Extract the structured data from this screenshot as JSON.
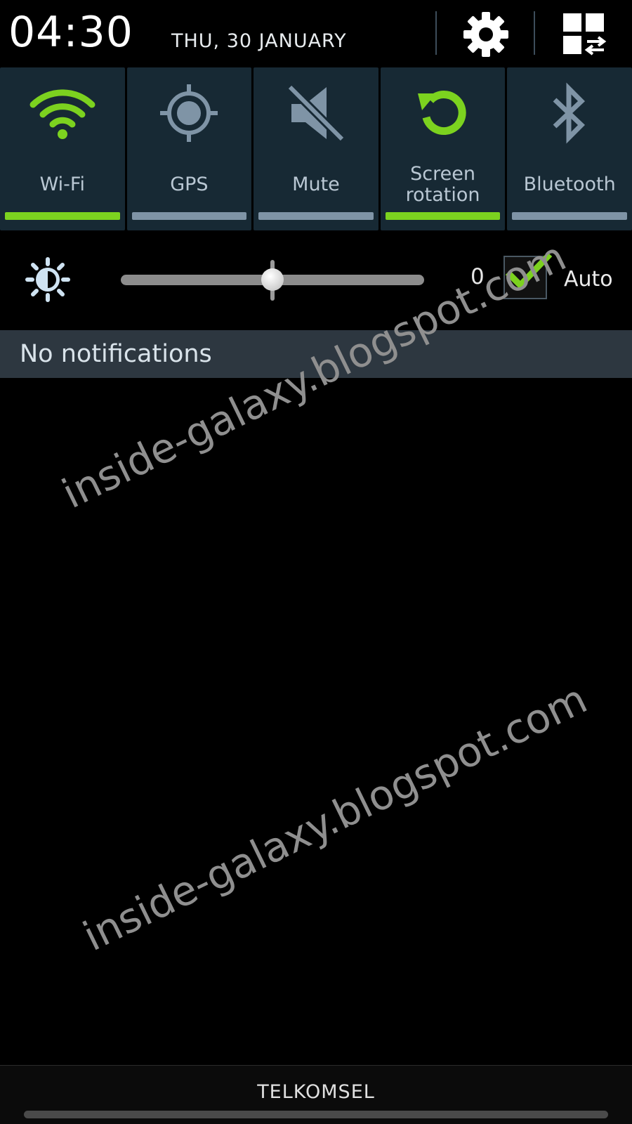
{
  "header": {
    "time": "04:30",
    "date": "THU, 30 JANUARY",
    "settings_icon": "gear-icon",
    "edit_icon": "grid-switch-icon"
  },
  "toggles": [
    {
      "label_line1": "Wi-Fi",
      "label_line2": "",
      "state": "on",
      "icon": "wifi-icon"
    },
    {
      "label_line1": "GPS",
      "label_line2": "",
      "state": "off",
      "icon": "gps-icon"
    },
    {
      "label_line1": "Mute",
      "label_line2": "",
      "state": "off",
      "icon": "mute-icon"
    },
    {
      "label_line1": "Screen",
      "label_line2": "rotation",
      "state": "on",
      "icon": "rotation-icon"
    },
    {
      "label_line1": "Bluetooth",
      "label_line2": "",
      "state": "off",
      "icon": "bluetooth-icon"
    }
  ],
  "brightness": {
    "icon": "brightness-icon",
    "value_label": "0",
    "slider_level": 0.5,
    "auto_checked": true,
    "auto_label": "Auto"
  },
  "notifications": {
    "empty_text": "No notifications"
  },
  "footer": {
    "carrier": "TELKOMSEL"
  },
  "watermark": {
    "text": "inside-galaxy.blogspot.com"
  },
  "colors": {
    "active": "#7cd21f",
    "inactive": "#7f94a6",
    "tile_bg": "#172934",
    "notif_bg": "#2d3740"
  }
}
